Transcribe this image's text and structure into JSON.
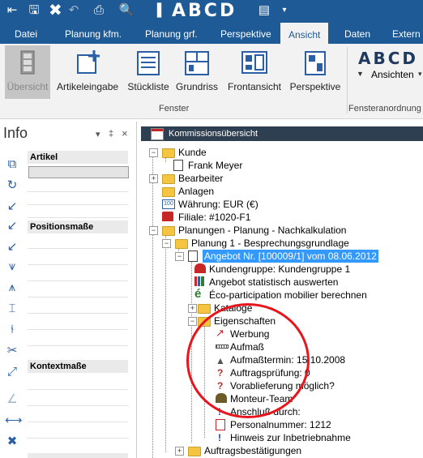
{
  "ribbon_tabs": [
    "Datei",
    "Planung kfm.",
    "Planung grf.",
    "Perspektive",
    "Ansicht",
    "Daten",
    "Extern"
  ],
  "active_tab": "Ansicht",
  "qat_logo": "ABCD",
  "ribbon": {
    "buttons": [
      "Übersicht",
      "Artikeleingabe",
      "Stückliste",
      "Grundriss",
      "Frontansicht",
      "Perspektive"
    ],
    "group_label": "Fenster",
    "right_logo": "ABCD",
    "right_button": "Ansichten",
    "right_group_label": "Fensteranordnung"
  },
  "info_panel": {
    "title": "Info",
    "pin": "‡",
    "close": "×",
    "sections": [
      "Artikel",
      "Positionsmaße",
      "Kontextmaße"
    ]
  },
  "tree_panel": {
    "title": "Kommissionsübersicht",
    "nodes": [
      {
        "text": "Kunde"
      },
      {
        "text": "Frank Meyer"
      },
      {
        "text": "Bearbeiter"
      },
      {
        "text": "Anlagen"
      },
      {
        "text": "Währung: EUR (€)"
      },
      {
        "text": "Filiale: #1020-F1"
      },
      {
        "text": "Planungen - Planung - Nachkalkulation"
      },
      {
        "text": "Planung  1 - Besprechungsgrundlage"
      },
      {
        "text": "Angebot Nr. [100009/1] vom 08.06.2012"
      },
      {
        "text": "Kundengruppe: Kundengruppe 1"
      },
      {
        "text": "Angebot statistisch auswerten"
      },
      {
        "text": "Éco-participation mobilier berechnen"
      },
      {
        "text": "Kataloge"
      },
      {
        "text": "Eigenschaften"
      },
      {
        "text": "Werbung"
      },
      {
        "text": "Aufmaß"
      },
      {
        "text": "Aufmaßtermin: 15.10.2008"
      },
      {
        "text": "Auftragsprüfung: 0"
      },
      {
        "text": "Vorablieferung möglich?"
      },
      {
        "text": "Monteur-Team"
      },
      {
        "text": "Anschluß durch:"
      },
      {
        "text": "Personalnummer: 1212"
      },
      {
        "text": "Hinweis zur Inbetriebnahme"
      },
      {
        "text": "Auftragsbestätigungen"
      }
    ]
  },
  "colors": {
    "accent": "#1e5a96",
    "ribbon_bg": "#f2f2f2",
    "selection": "#3399ff",
    "annotation": "#e8151c"
  }
}
